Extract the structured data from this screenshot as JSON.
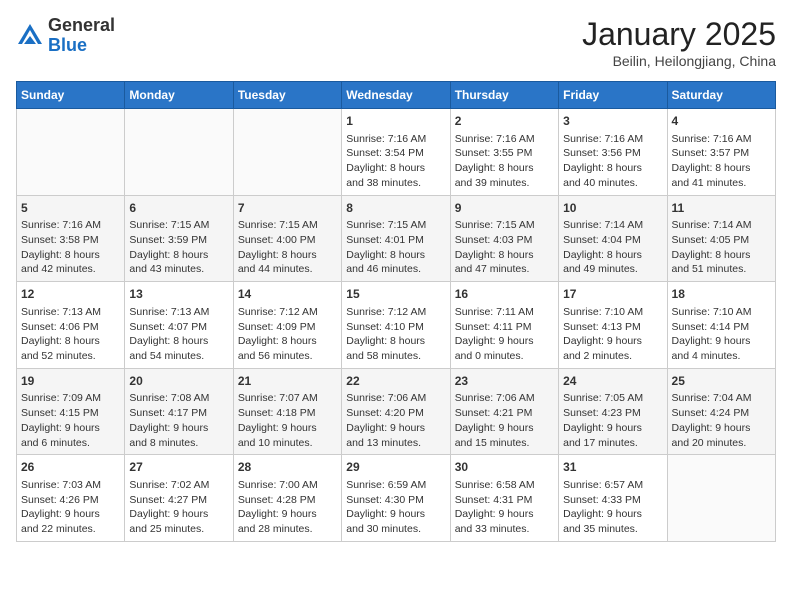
{
  "header": {
    "logo_line1": "General",
    "logo_line2": "Blue",
    "title": "January 2025",
    "subtitle": "Beilin, Heilongjiang, China"
  },
  "days_of_week": [
    "Sunday",
    "Monday",
    "Tuesday",
    "Wednesday",
    "Thursday",
    "Friday",
    "Saturday"
  ],
  "weeks": [
    [
      {
        "day": "",
        "info": ""
      },
      {
        "day": "",
        "info": ""
      },
      {
        "day": "",
        "info": ""
      },
      {
        "day": "1",
        "info": "Sunrise: 7:16 AM\nSunset: 3:54 PM\nDaylight: 8 hours\nand 38 minutes."
      },
      {
        "day": "2",
        "info": "Sunrise: 7:16 AM\nSunset: 3:55 PM\nDaylight: 8 hours\nand 39 minutes."
      },
      {
        "day": "3",
        "info": "Sunrise: 7:16 AM\nSunset: 3:56 PM\nDaylight: 8 hours\nand 40 minutes."
      },
      {
        "day": "4",
        "info": "Sunrise: 7:16 AM\nSunset: 3:57 PM\nDaylight: 8 hours\nand 41 minutes."
      }
    ],
    [
      {
        "day": "5",
        "info": "Sunrise: 7:16 AM\nSunset: 3:58 PM\nDaylight: 8 hours\nand 42 minutes."
      },
      {
        "day": "6",
        "info": "Sunrise: 7:15 AM\nSunset: 3:59 PM\nDaylight: 8 hours\nand 43 minutes."
      },
      {
        "day": "7",
        "info": "Sunrise: 7:15 AM\nSunset: 4:00 PM\nDaylight: 8 hours\nand 44 minutes."
      },
      {
        "day": "8",
        "info": "Sunrise: 7:15 AM\nSunset: 4:01 PM\nDaylight: 8 hours\nand 46 minutes."
      },
      {
        "day": "9",
        "info": "Sunrise: 7:15 AM\nSunset: 4:03 PM\nDaylight: 8 hours\nand 47 minutes."
      },
      {
        "day": "10",
        "info": "Sunrise: 7:14 AM\nSunset: 4:04 PM\nDaylight: 8 hours\nand 49 minutes."
      },
      {
        "day": "11",
        "info": "Sunrise: 7:14 AM\nSunset: 4:05 PM\nDaylight: 8 hours\nand 51 minutes."
      }
    ],
    [
      {
        "day": "12",
        "info": "Sunrise: 7:13 AM\nSunset: 4:06 PM\nDaylight: 8 hours\nand 52 minutes."
      },
      {
        "day": "13",
        "info": "Sunrise: 7:13 AM\nSunset: 4:07 PM\nDaylight: 8 hours\nand 54 minutes."
      },
      {
        "day": "14",
        "info": "Sunrise: 7:12 AM\nSunset: 4:09 PM\nDaylight: 8 hours\nand 56 minutes."
      },
      {
        "day": "15",
        "info": "Sunrise: 7:12 AM\nSunset: 4:10 PM\nDaylight: 8 hours\nand 58 minutes."
      },
      {
        "day": "16",
        "info": "Sunrise: 7:11 AM\nSunset: 4:11 PM\nDaylight: 9 hours\nand 0 minutes."
      },
      {
        "day": "17",
        "info": "Sunrise: 7:10 AM\nSunset: 4:13 PM\nDaylight: 9 hours\nand 2 minutes."
      },
      {
        "day": "18",
        "info": "Sunrise: 7:10 AM\nSunset: 4:14 PM\nDaylight: 9 hours\nand 4 minutes."
      }
    ],
    [
      {
        "day": "19",
        "info": "Sunrise: 7:09 AM\nSunset: 4:15 PM\nDaylight: 9 hours\nand 6 minutes."
      },
      {
        "day": "20",
        "info": "Sunrise: 7:08 AM\nSunset: 4:17 PM\nDaylight: 9 hours\nand 8 minutes."
      },
      {
        "day": "21",
        "info": "Sunrise: 7:07 AM\nSunset: 4:18 PM\nDaylight: 9 hours\nand 10 minutes."
      },
      {
        "day": "22",
        "info": "Sunrise: 7:06 AM\nSunset: 4:20 PM\nDaylight: 9 hours\nand 13 minutes."
      },
      {
        "day": "23",
        "info": "Sunrise: 7:06 AM\nSunset: 4:21 PM\nDaylight: 9 hours\nand 15 minutes."
      },
      {
        "day": "24",
        "info": "Sunrise: 7:05 AM\nSunset: 4:23 PM\nDaylight: 9 hours\nand 17 minutes."
      },
      {
        "day": "25",
        "info": "Sunrise: 7:04 AM\nSunset: 4:24 PM\nDaylight: 9 hours\nand 20 minutes."
      }
    ],
    [
      {
        "day": "26",
        "info": "Sunrise: 7:03 AM\nSunset: 4:26 PM\nDaylight: 9 hours\nand 22 minutes."
      },
      {
        "day": "27",
        "info": "Sunrise: 7:02 AM\nSunset: 4:27 PM\nDaylight: 9 hours\nand 25 minutes."
      },
      {
        "day": "28",
        "info": "Sunrise: 7:00 AM\nSunset: 4:28 PM\nDaylight: 9 hours\nand 28 minutes."
      },
      {
        "day": "29",
        "info": "Sunrise: 6:59 AM\nSunset: 4:30 PM\nDaylight: 9 hours\nand 30 minutes."
      },
      {
        "day": "30",
        "info": "Sunrise: 6:58 AM\nSunset: 4:31 PM\nDaylight: 9 hours\nand 33 minutes."
      },
      {
        "day": "31",
        "info": "Sunrise: 6:57 AM\nSunset: 4:33 PM\nDaylight: 9 hours\nand 35 minutes."
      },
      {
        "day": "",
        "info": ""
      }
    ]
  ]
}
